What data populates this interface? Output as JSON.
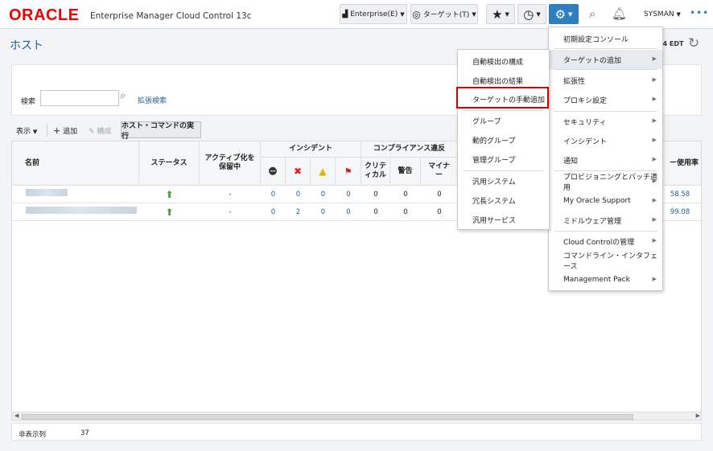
{
  "header": {
    "logo": "ORACLE",
    "product": "Enterprise Manager Cloud Control 13c",
    "enterprise_menu": "Enterprise(E)",
    "target_menu": "ターゲット(T)",
    "user": "SYSMAN"
  },
  "page": {
    "title": "ホスト",
    "time_partial": "14 EDT"
  },
  "search": {
    "label": "検索",
    "value": "",
    "advanced_link": "拡張検索"
  },
  "toolbar": {
    "view": "表示",
    "add": "追加",
    "configure": "構成",
    "run_command": "ホスト・コマンドの実行"
  },
  "table": {
    "headers": {
      "name": "名前",
      "status": "ステータス",
      "blackout": "アクティブ化を保留中",
      "incidents": "インシデント",
      "compliance": "コンプライアンス違反",
      "critical": "クリティカル",
      "warning": "警告",
      "minor": "マイナー",
      "memory": "ー使用率"
    },
    "rows": [
      {
        "blackout": "-",
        "inc": [
          "0",
          "0",
          "0",
          "0"
        ],
        "comp": [
          "0",
          "0",
          "0"
        ],
        "memory": "58.58"
      },
      {
        "blackout": "-",
        "inc": [
          "0",
          "2",
          "0",
          "0"
        ],
        "comp": [
          "0",
          "0",
          "0"
        ],
        "memory": "99.08"
      }
    ]
  },
  "footer": {
    "hidden_columns_label": "非表示列",
    "hidden_columns_count": "37"
  },
  "setup_menu": {
    "items": [
      "初期設定コンソール",
      "ターゲットの追加",
      "拡張性",
      "プロキシ設定",
      "セキュリティ",
      "インシデント",
      "通知",
      "プロビジョニングとパッチ適用",
      "My Oracle Support",
      "ミドルウェア管理",
      "Cloud Controlの管理",
      "コマンドライン・インタフェース",
      "Management Pack"
    ]
  },
  "add_target_submenu": {
    "items": [
      "自動検出の構成",
      "自動検出の結果",
      "ターゲットの手動追加",
      "グループ",
      "動的グループ",
      "管理グループ",
      "汎用システム",
      "冗長システム",
      "汎用サービス"
    ]
  },
  "colors": {
    "oracle_red": "#e00000",
    "accent_blue": "#2e7fc1",
    "status_up": "#4a9a3c",
    "highlight_box": "#d10000"
  }
}
